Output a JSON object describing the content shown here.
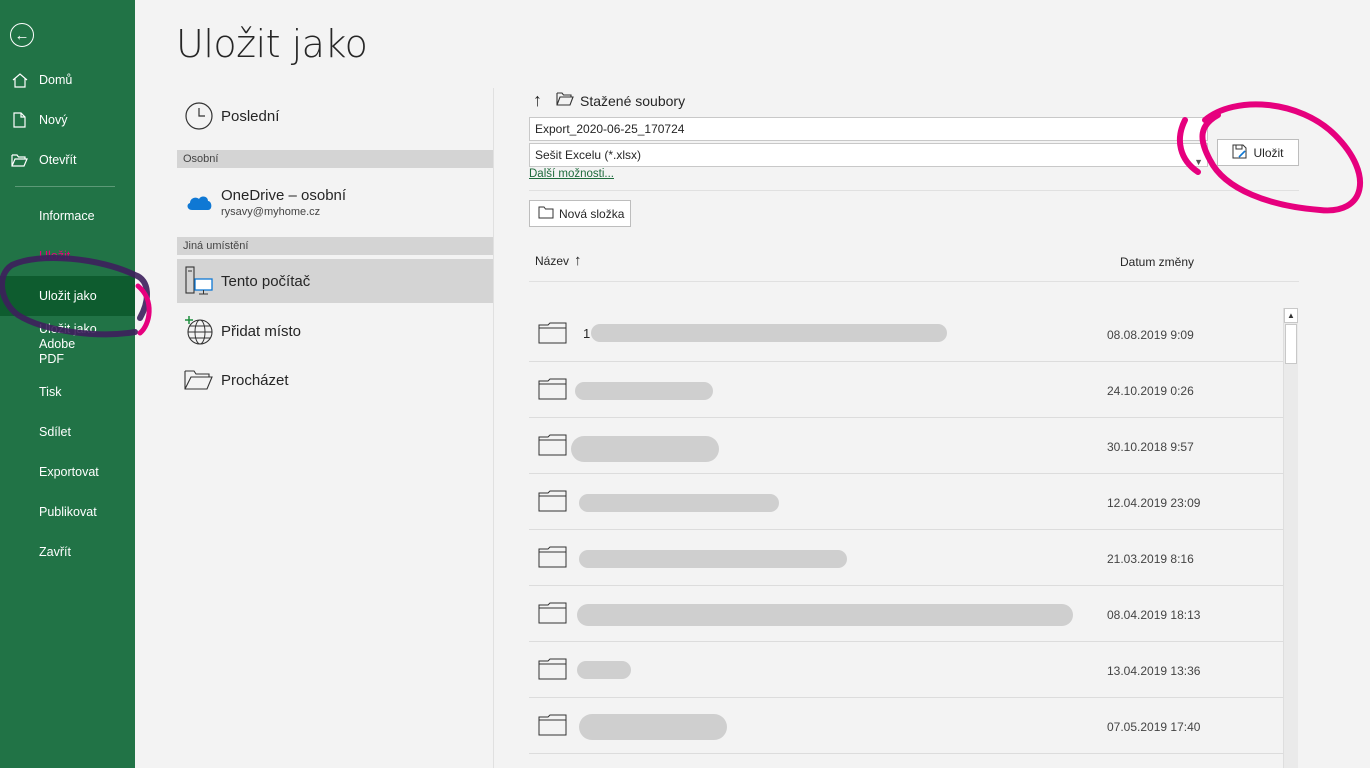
{
  "page_title": "Uložit jako",
  "sidebar": {
    "items": [
      {
        "label": "Domů"
      },
      {
        "label": "Nový"
      },
      {
        "label": "Otevřít"
      },
      {
        "label": "Informace"
      },
      {
        "label": "Uložit"
      },
      {
        "label": "Uložit jako"
      },
      {
        "label": "Uložit jako Adobe PDF"
      },
      {
        "label": "Tisk"
      },
      {
        "label": "Sdílet"
      },
      {
        "label": "Exportovat"
      },
      {
        "label": "Publikovat"
      },
      {
        "label": "Zavřít"
      }
    ]
  },
  "locations": {
    "recent": "Poslední",
    "personal_header": "Osobní",
    "onedrive_name": "OneDrive – osobní",
    "onedrive_email": "rysavy@myhome.cz",
    "other_header": "Jiná umístění",
    "this_pc": "Tento počítač",
    "add_place": "Přidat místo",
    "browse": "Procházet"
  },
  "save": {
    "current_folder": "Stažené soubory",
    "filename": "Export_2020-06-25_170724",
    "filetype": "Sešit Excelu (*.xlsx)",
    "save_label": "Uložit",
    "more_options": "Další možnosti...",
    "new_folder": "Nová složka"
  },
  "columns": {
    "name": "Název",
    "date": "Datum změny"
  },
  "files": [
    {
      "name": "1",
      "date": "08.08.2019 9:09"
    },
    {
      "name": "",
      "date": "24.10.2019 0:26"
    },
    {
      "name": "",
      "date": "30.10.2018 9:57"
    },
    {
      "name": "",
      "date": "12.04.2019 23:09"
    },
    {
      "name": "",
      "date": "21.03.2019 8:16"
    },
    {
      "name": "",
      "date": "08.04.2019 18:13"
    },
    {
      "name": "",
      "date": "13.04.2019 13:36"
    },
    {
      "name": "",
      "date": "07.05.2019 17:40"
    }
  ],
  "colors": {
    "sidebar": "#217346",
    "sidebar_active": "#0e5c2f",
    "link": "#1e6b3c",
    "annotation": "#e6007e"
  }
}
